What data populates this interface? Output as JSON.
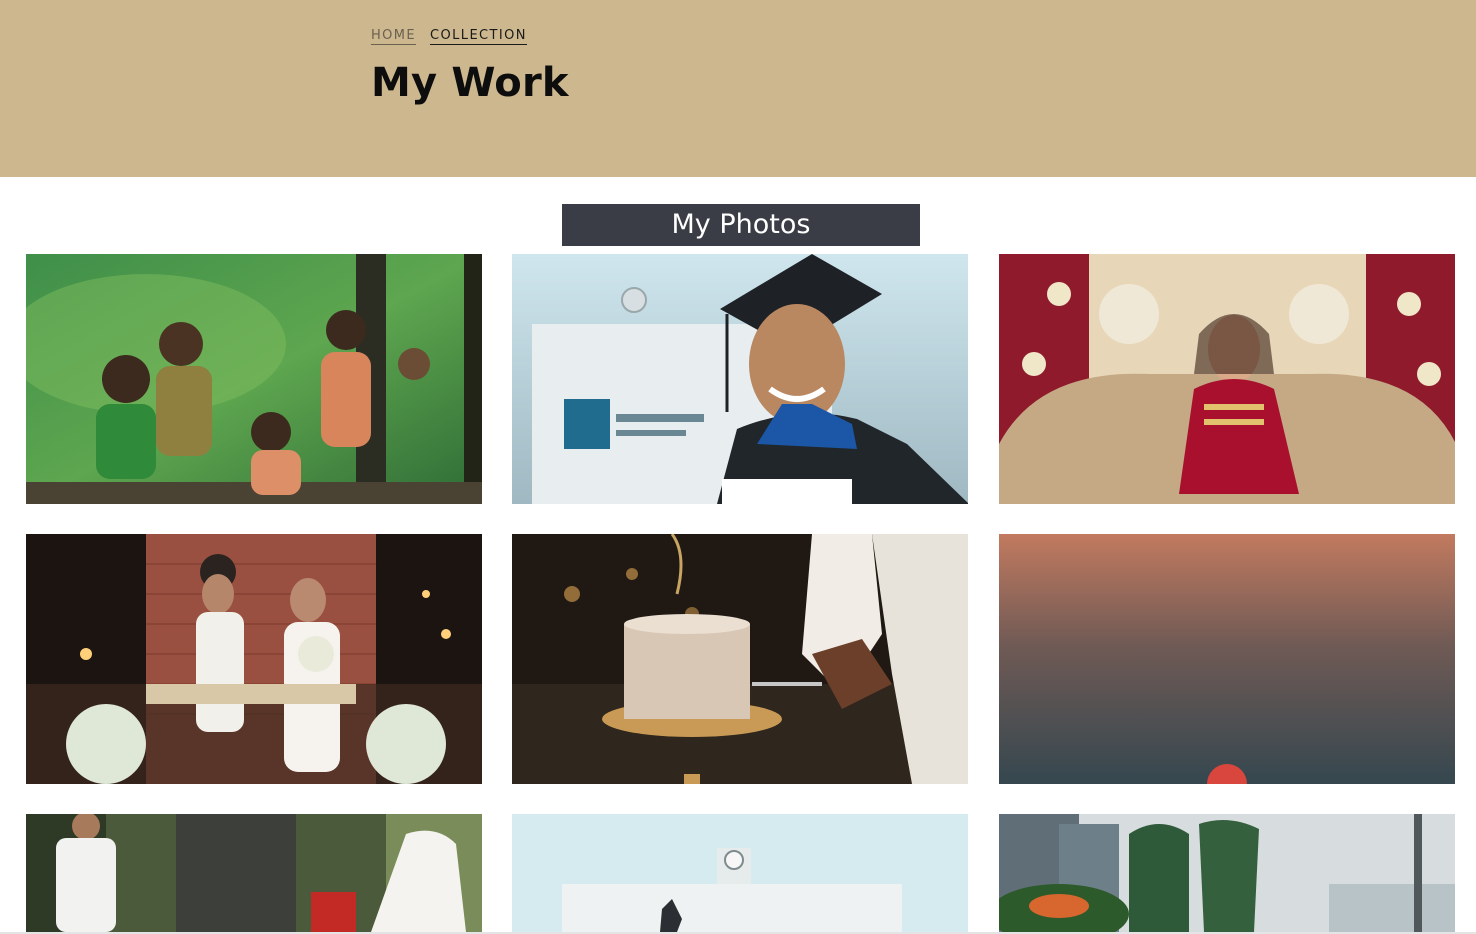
{
  "breadcrumb": {
    "home": "HOME",
    "current": "COLLECTION"
  },
  "page": {
    "title": "My Work"
  },
  "gallery": {
    "heading": "My Photos"
  },
  "colors": {
    "hero_background": "#cdb78e",
    "heading_bar": "#3a3d45"
  }
}
